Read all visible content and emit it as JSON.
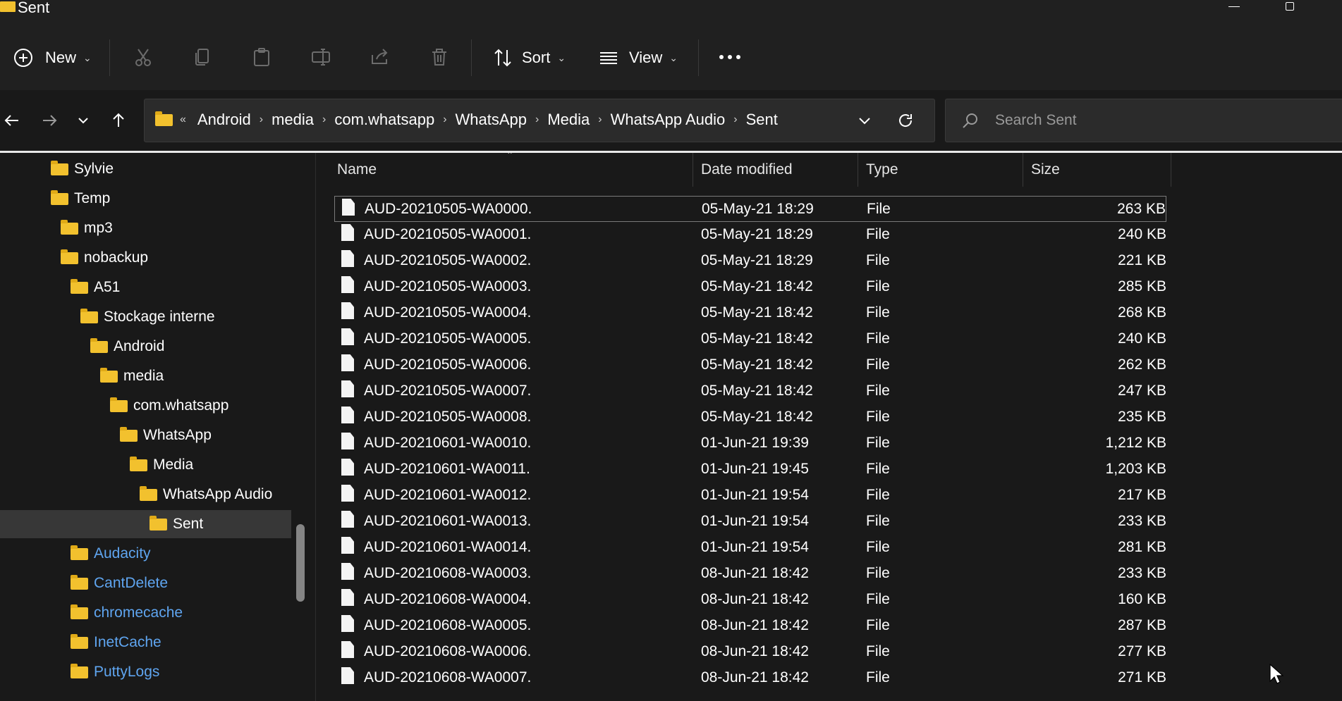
{
  "window": {
    "title": "Sent"
  },
  "toolbar": {
    "new_label": "New",
    "sort_label": "Sort",
    "view_label": "View"
  },
  "breadcrumb": [
    "Android",
    "media",
    "com.whatsapp",
    "WhatsApp",
    "Media",
    "WhatsApp Audio",
    "Sent"
  ],
  "search": {
    "placeholder": "Search Sent"
  },
  "nav_tree": [
    {
      "label": "Sylvie",
      "level": 0
    },
    {
      "label": "Temp",
      "level": 0
    },
    {
      "label": "mp3",
      "level": 1
    },
    {
      "label": "nobackup",
      "level": 1
    },
    {
      "label": "A51",
      "level": 2
    },
    {
      "label": "Stockage interne",
      "level": 3
    },
    {
      "label": "Android",
      "level": 4
    },
    {
      "label": "media",
      "level": 5
    },
    {
      "label": "com.whatsapp",
      "level": 6
    },
    {
      "label": "WhatsApp",
      "level": 7
    },
    {
      "label": "Media",
      "level": 8
    },
    {
      "label": "WhatsApp Audio",
      "level": 9
    },
    {
      "label": "Sent",
      "level": 10,
      "selected": true
    },
    {
      "label": "Audacity",
      "level": 2,
      "link": true
    },
    {
      "label": "CantDelete",
      "level": 2,
      "link": true
    },
    {
      "label": "chromecache",
      "level": 2,
      "link": true
    },
    {
      "label": "InetCache",
      "level": 2,
      "link": true
    },
    {
      "label": "PuttyLogs",
      "level": 2,
      "link": true
    }
  ],
  "columns": {
    "name": "Name",
    "date": "Date modified",
    "type": "Type",
    "size": "Size"
  },
  "files": [
    {
      "name": "AUD-20210505-WA0000.",
      "date": "05-May-21 18:29",
      "type": "File",
      "size": "263 KB"
    },
    {
      "name": "AUD-20210505-WA0001.",
      "date": "05-May-21 18:29",
      "type": "File",
      "size": "240 KB"
    },
    {
      "name": "AUD-20210505-WA0002.",
      "date": "05-May-21 18:29",
      "type": "File",
      "size": "221 KB"
    },
    {
      "name": "AUD-20210505-WA0003.",
      "date": "05-May-21 18:42",
      "type": "File",
      "size": "285 KB"
    },
    {
      "name": "AUD-20210505-WA0004.",
      "date": "05-May-21 18:42",
      "type": "File",
      "size": "268 KB"
    },
    {
      "name": "AUD-20210505-WA0005.",
      "date": "05-May-21 18:42",
      "type": "File",
      "size": "240 KB"
    },
    {
      "name": "AUD-20210505-WA0006.",
      "date": "05-May-21 18:42",
      "type": "File",
      "size": "262 KB"
    },
    {
      "name": "AUD-20210505-WA0007.",
      "date": "05-May-21 18:42",
      "type": "File",
      "size": "247 KB"
    },
    {
      "name": "AUD-20210505-WA0008.",
      "date": "05-May-21 18:42",
      "type": "File",
      "size": "235 KB"
    },
    {
      "name": "AUD-20210601-WA0010.",
      "date": "01-Jun-21 19:39",
      "type": "File",
      "size": "1,212 KB"
    },
    {
      "name": "AUD-20210601-WA0011.",
      "date": "01-Jun-21 19:45",
      "type": "File",
      "size": "1,203 KB"
    },
    {
      "name": "AUD-20210601-WA0012.",
      "date": "01-Jun-21 19:54",
      "type": "File",
      "size": "217 KB"
    },
    {
      "name": "AUD-20210601-WA0013.",
      "date": "01-Jun-21 19:54",
      "type": "File",
      "size": "233 KB"
    },
    {
      "name": "AUD-20210601-WA0014.",
      "date": "01-Jun-21 19:54",
      "type": "File",
      "size": "281 KB"
    },
    {
      "name": "AUD-20210608-WA0003.",
      "date": "08-Jun-21 18:42",
      "type": "File",
      "size": "233 KB"
    },
    {
      "name": "AUD-20210608-WA0004.",
      "date": "08-Jun-21 18:42",
      "type": "File",
      "size": "160 KB"
    },
    {
      "name": "AUD-20210608-WA0005.",
      "date": "08-Jun-21 18:42",
      "type": "File",
      "size": "287 KB"
    },
    {
      "name": "AUD-20210608-WA0006.",
      "date": "08-Jun-21 18:42",
      "type": "File",
      "size": "277 KB"
    },
    {
      "name": "AUD-20210608-WA0007.",
      "date": "08-Jun-21 18:42",
      "type": "File",
      "size": "271 KB"
    }
  ]
}
